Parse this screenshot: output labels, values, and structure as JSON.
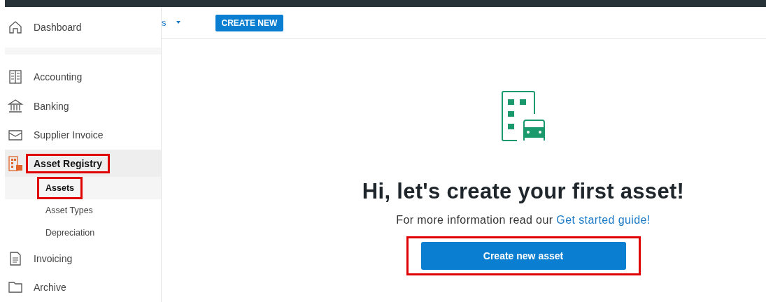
{
  "toolbar": {
    "menu_fragment": "s",
    "create_button": "CREATE NEW"
  },
  "sidebar": {
    "items": [
      {
        "label": "Dashboard",
        "kind": "home",
        "selected": false,
        "highlighted": false
      },
      {
        "label": "Accounting",
        "kind": "book",
        "selected": false,
        "highlighted": false
      },
      {
        "label": "Banking",
        "kind": "bank",
        "selected": false,
        "highlighted": false
      },
      {
        "label": "Supplier Invoice",
        "kind": "inbox",
        "selected": false,
        "highlighted": false
      },
      {
        "label": "Asset Registry",
        "kind": "asset",
        "selected": true,
        "highlighted": true,
        "children": [
          {
            "label": "Assets",
            "selected": true,
            "highlighted": true
          },
          {
            "label": "Asset Types",
            "selected": false,
            "highlighted": false
          },
          {
            "label": "Depreciation",
            "selected": false,
            "highlighted": false
          }
        ]
      },
      {
        "label": "Invoicing",
        "kind": "document",
        "selected": false,
        "highlighted": false
      },
      {
        "label": "Archive",
        "kind": "folder",
        "selected": false,
        "highlighted": false
      }
    ]
  },
  "empty_state": {
    "heading": "Hi, let's create your first asset!",
    "text": "For more information read our",
    "link": "Get started guide!",
    "button": "Create new asset",
    "button_highlighted": true
  }
}
